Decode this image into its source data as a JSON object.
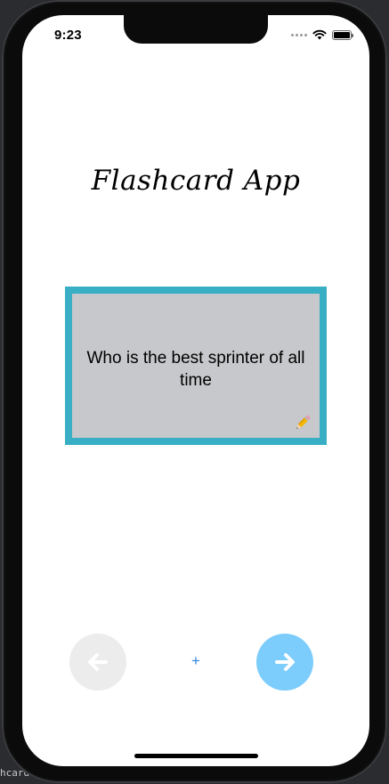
{
  "status_bar": {
    "time": "9:23"
  },
  "app": {
    "title": "Flashcard App"
  },
  "card": {
    "question": "Who is the best sprinter of all time",
    "edit_icon": "pencil-icon",
    "border_color": "#38afc4",
    "background_color": "#c7c8cb"
  },
  "controls": {
    "prev_icon": "arrow-left-icon",
    "add_label": "+",
    "next_icon": "arrow-right-icon",
    "prev_color": "#ececed",
    "next_color": "#7dcdfc",
    "add_color": "#2e86de"
  },
  "background": {
    "partial_text": "hcard"
  }
}
